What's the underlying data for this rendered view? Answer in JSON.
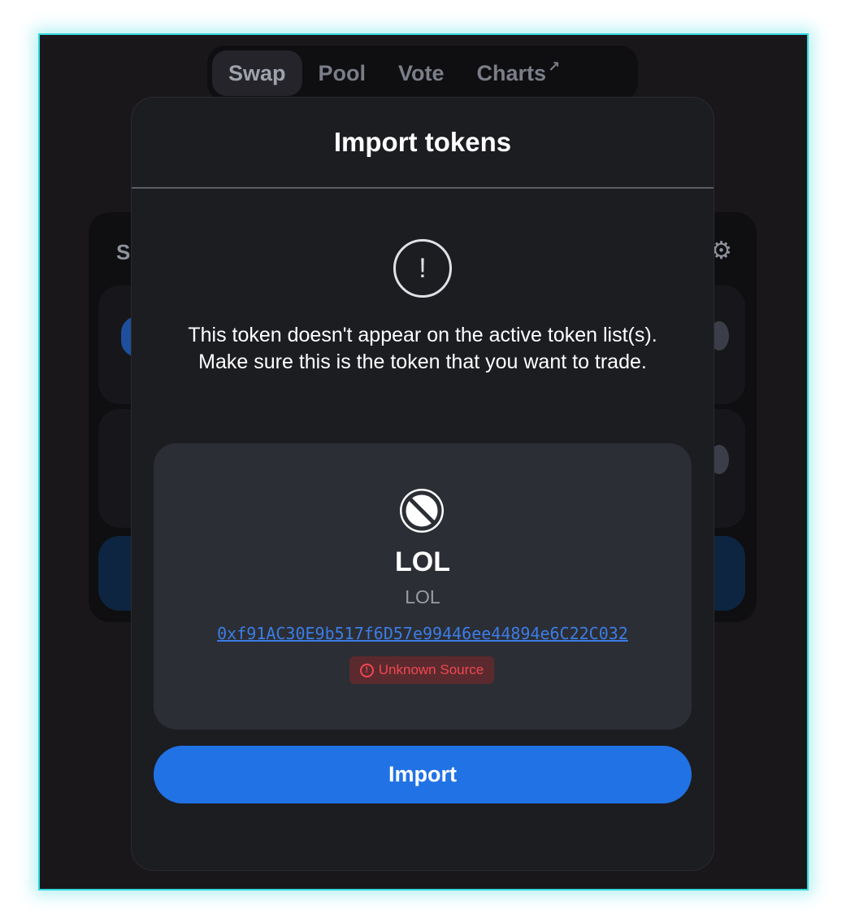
{
  "nav": {
    "items": [
      {
        "label": "Swap",
        "active": true
      },
      {
        "label": "Pool",
        "active": false
      },
      {
        "label": "Vote",
        "active": false
      },
      {
        "label": "Charts",
        "active": false,
        "external_icon": "↗"
      }
    ]
  },
  "background_card": {
    "title_fragment": "S",
    "gear_icon": "gear-icon"
  },
  "modal": {
    "title": "Import tokens",
    "warning_icon": "!",
    "warning_text": "This token doesn't appear on the active token list(s). Make sure this is the token that you want to trade.",
    "token": {
      "symbol": "LOL",
      "name": "LOL",
      "address": "0xf91AC30E9b517f6D57e99446ee44894e6C22C032",
      "badge_label": "Unknown Source",
      "badge_icon": "!"
    },
    "import_label": "Import"
  },
  "colors": {
    "accent": "#2172e5",
    "danger": "#f0484f",
    "frame_border": "#33d6dc"
  }
}
